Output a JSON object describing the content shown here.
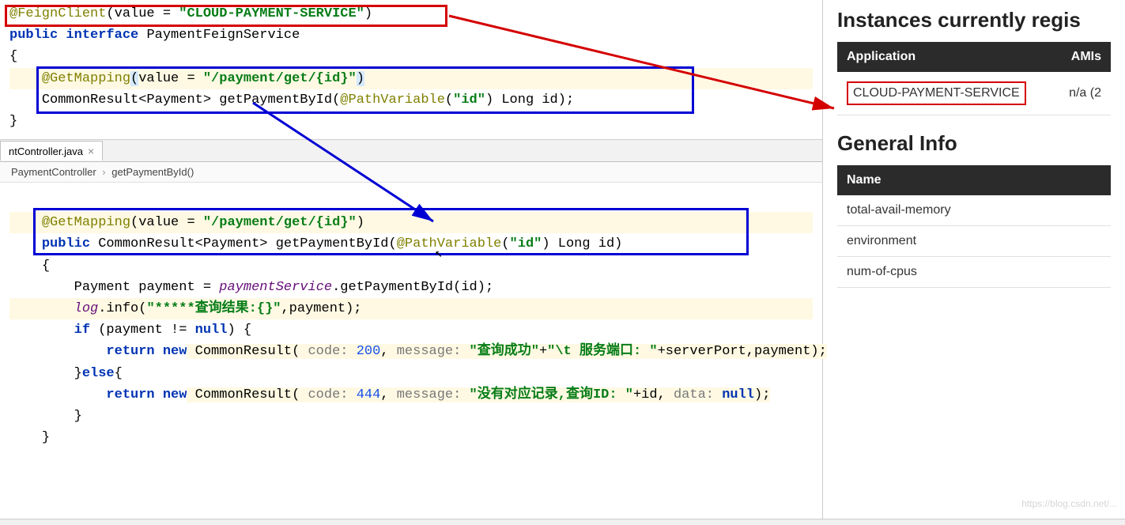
{
  "top": {
    "line1_anno": "@FeignClient",
    "line1_value_kw": "value = ",
    "line1_value_str": "\"CLOUD-PAYMENT-SERVICE\"",
    "line2_kw": "public interface",
    "line2_name": "PaymentFeignService",
    "line3_brace": "{",
    "line4_anno": "@GetMapping",
    "line4_value_kw": "value = ",
    "line4_value_str": "\"/payment/get/{id}\"",
    "line5_ret": "CommonResult<Payment>",
    "line5_method": "getPaymentById",
    "line5_pv": "@PathVariable",
    "line5_pv_str": "\"id\"",
    "line5_rest": " Long id);",
    "line6_brace": "}"
  },
  "tab": {
    "name": "ntController.java"
  },
  "breadcrumb": {
    "item1": "PaymentController",
    "item2": "getPaymentById()"
  },
  "bottom": {
    "l1_anno": "@GetMapping",
    "l1_val_kw": "value = ",
    "l1_val_str": "\"/payment/get/{id}\"",
    "l2_kw": "public",
    "l2_ret": "CommonResult<Payment>",
    "l2_method": "getPaymentById",
    "l2_pv": "@PathVariable",
    "l2_pv_str": "\"id\"",
    "l2_rest": " Long id)",
    "l3": "{",
    "l4_type": "Payment",
    "l4_var": "payment = ",
    "l4_field": "paymentService",
    "l4_call": ".getPaymentById(id);",
    "l5_log": "log",
    "l5_call": ".info(",
    "l5_str": "\"*****查询结果:{}\"",
    "l5_rest": ",payment);",
    "l6_kw": "if",
    "l6_cond": " (payment != ",
    "l6_null": "null",
    "l6_rest": ") {",
    "l7_kw": "return new",
    "l7_type": " CommonResult( ",
    "l7_hint1": "code: ",
    "l7_code": "200",
    "l7_sep1": ", ",
    "l7_hint2": "message: ",
    "l7_str": "\"查询成功\"",
    "l7_plus1": "+",
    "l7_str2": "\"\\t 服务端口: \"",
    "l7_plus2": "+serverPort,payment);",
    "l8": "}",
    "l8_kw": "else",
    "l8_rest": "{",
    "l9_kw": "return new",
    "l9_type": " CommonResult( ",
    "l9_hint1": "code: ",
    "l9_code": "444",
    "l9_sep1": ", ",
    "l9_hint2": "message: ",
    "l9_str": "\"没有对应记录,查询ID: \"",
    "l9_plus": "+id, ",
    "l9_hint3": "data: ",
    "l9_null": "null",
    "l9_rest": ");",
    "l10": "}",
    "l11": "}"
  },
  "right": {
    "title1": "Instances currently regis",
    "th_app": "Application",
    "th_amis": "AMIs",
    "app_name": "CLOUD-PAYMENT-SERVICE",
    "app_amis": "n/a (2",
    "title2": "General Info",
    "th_name": "Name",
    "row1": "total-avail-memory",
    "row2": "environment",
    "row3": "num-of-cpus"
  },
  "watermark": "https://blog.csdn.net/..."
}
